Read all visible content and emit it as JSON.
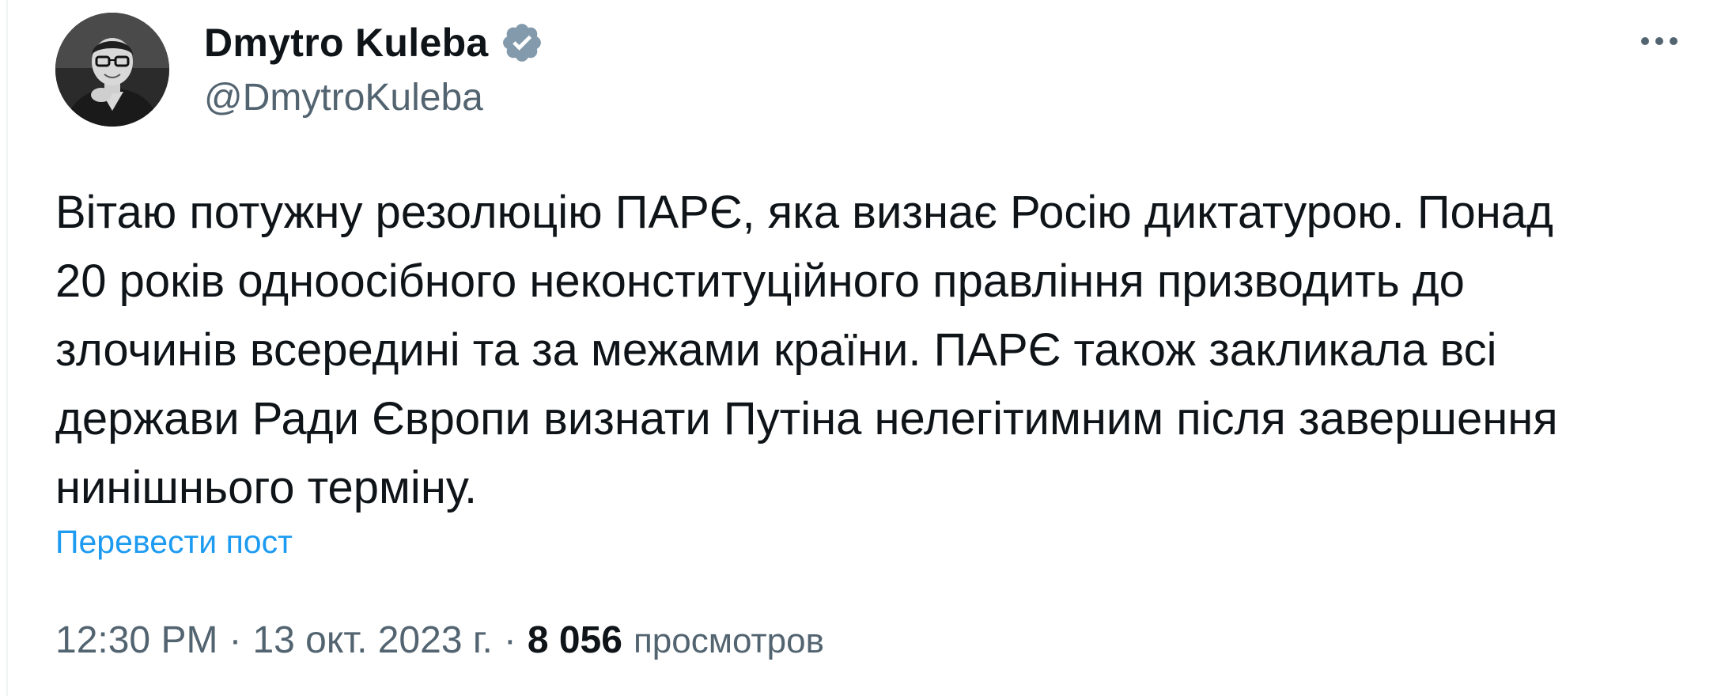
{
  "author": {
    "display_name": "Dmytro Kuleba",
    "handle": "@DmytroKuleba",
    "verified": true,
    "verified_icon": "verified-badge-icon",
    "avatar_icon": "profile-photo"
  },
  "more_icon": "more-horizontal-icon",
  "post": {
    "text": "Вітаю потужну резолюцію ПАРЄ, яка визнає Росію диктатурою. Понад\n20 років одноосібного неконституційного правління призводить до\nзлочинів всередині та за межами країни. ПАРЄ також закликала всі\nдержави Ради Європи визнати Путіна нелегітимним після завершення\nнинішнього терміну.",
    "translate_label": "Перевести пост"
  },
  "meta": {
    "time": "12:30 PM",
    "separator": "·",
    "date": "13 окт. 2023 г.",
    "views_count": "8 056",
    "views_label": "просмотров"
  },
  "colors": {
    "text_primary": "#0f1419",
    "text_secondary": "#536471",
    "link": "#1d9bf0",
    "verified": "#829aab"
  }
}
